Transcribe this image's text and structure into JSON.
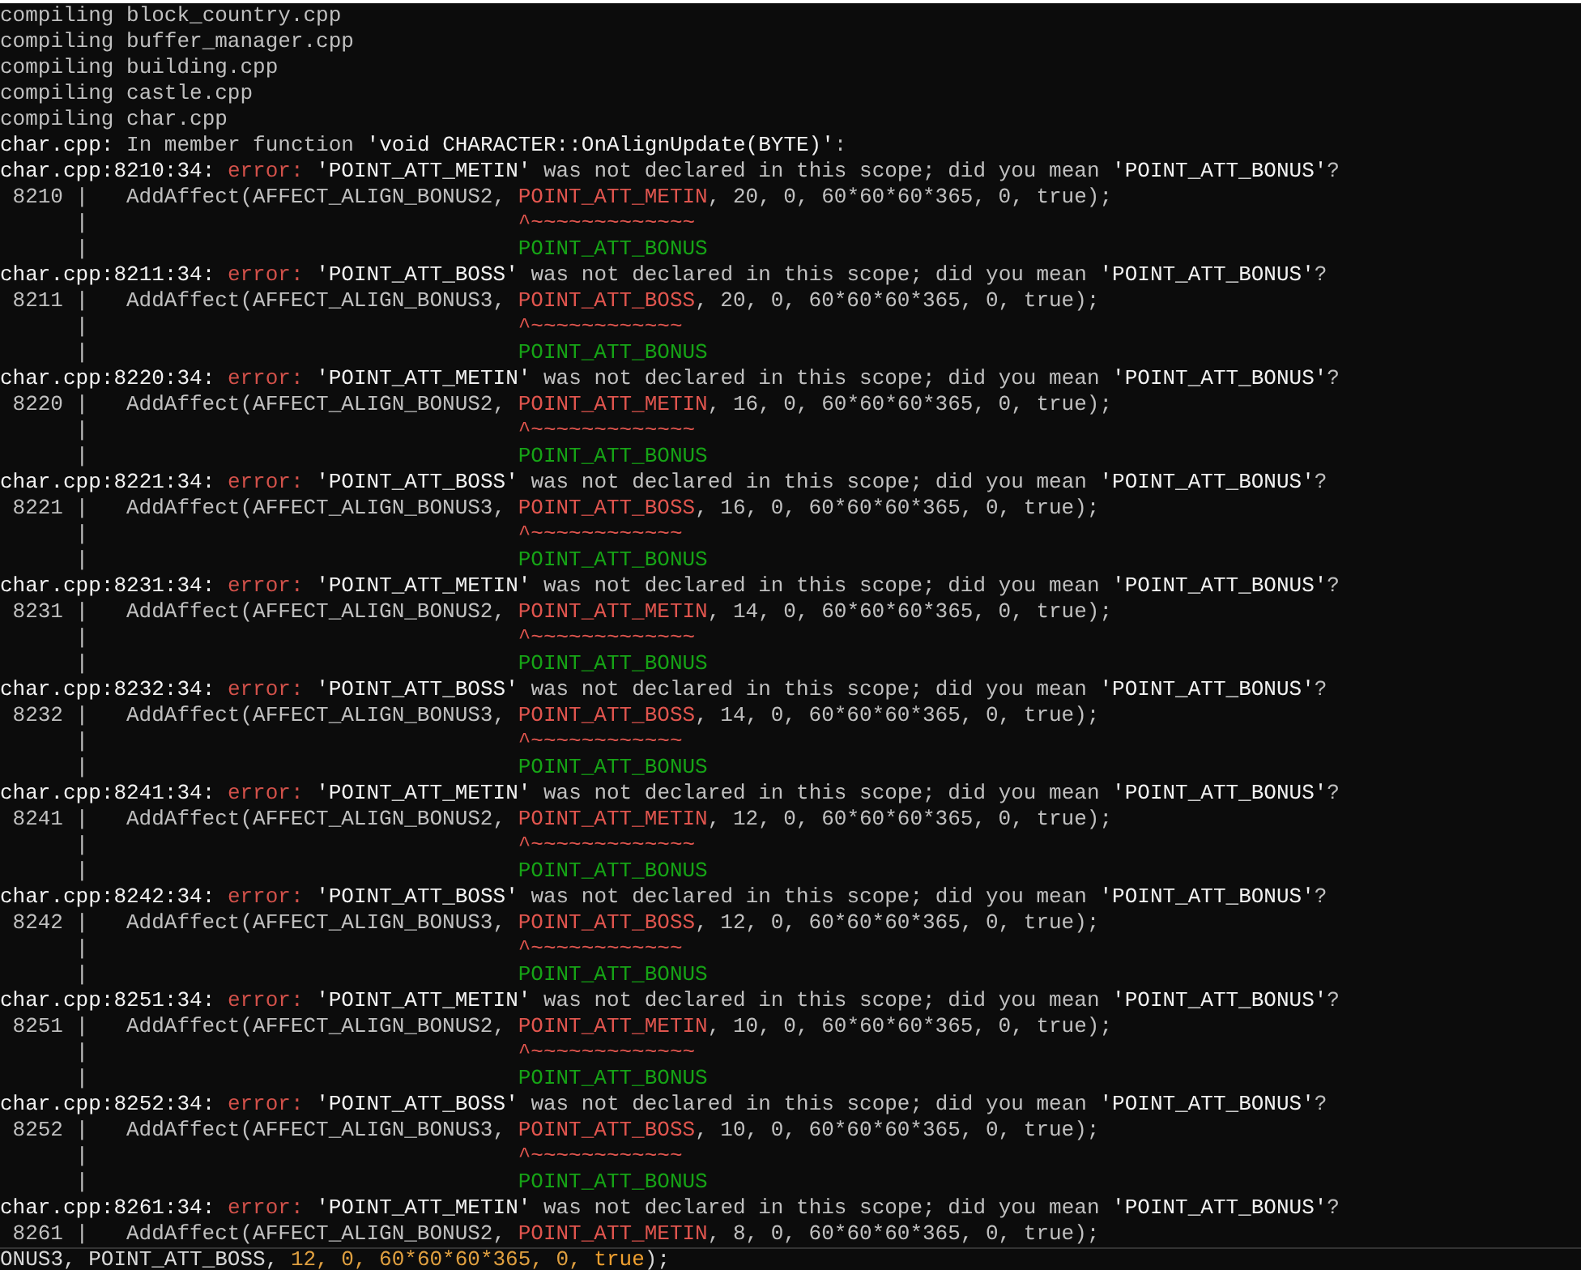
{
  "lines": [
    {
      "kind": "compile",
      "text": "compiling block_country.cpp"
    },
    {
      "kind": "compile",
      "text": "compiling buffer_manager.cpp"
    },
    {
      "kind": "compile",
      "text": "compiling building.cpp"
    },
    {
      "kind": "compile",
      "text": "compiling castle.cpp"
    },
    {
      "kind": "compile",
      "text": "compiling char.cpp"
    },
    {
      "kind": "note",
      "location": "char.cpp:",
      "message": "In member function **'void CHARACTER::OnAlignUpdate(BYTE)'**:"
    },
    {
      "kind": "diagnostic",
      "location": "char.cpp:8210:34:",
      "severity": "error:",
      "message": "**'POINT_ATT_METIN'** was not declared in this scope; did you mean **'POINT_ATT_BONUS'**?",
      "line_number": "8210",
      "gutter": "|",
      "code_before": "AddAffect(AFFECT_ALIGN_BONUS2, ",
      "code_highlight": "POINT_ATT_METIN",
      "code_after": ", 20, 0, 60*60*60*365, 0, true);",
      "caret_gutter": "|",
      "caret": "^~~~~~~~~~~~~~",
      "fixit_gutter": "|",
      "fixit": "POINT_ATT_BONUS"
    },
    {
      "kind": "diagnostic",
      "location": "char.cpp:8211:34:",
      "severity": "error:",
      "message": "**'POINT_ATT_BOSS'** was not declared in this scope; did you mean **'POINT_ATT_BONUS'**?",
      "line_number": "8211",
      "gutter": "|",
      "code_before": "AddAffect(AFFECT_ALIGN_BONUS3, ",
      "code_highlight": "POINT_ATT_BOSS",
      "code_after": ", 20, 0, 60*60*60*365, 0, true);",
      "caret_gutter": "|",
      "caret": "^~~~~~~~~~~~~",
      "fixit_gutter": "|",
      "fixit": "POINT_ATT_BONUS"
    },
    {
      "kind": "diagnostic",
      "location": "char.cpp:8220:34:",
      "severity": "error:",
      "message": "**'POINT_ATT_METIN'** was not declared in this scope; did you mean **'POINT_ATT_BONUS'**?",
      "line_number": "8220",
      "gutter": "|",
      "code_before": "AddAffect(AFFECT_ALIGN_BONUS2, ",
      "code_highlight": "POINT_ATT_METIN",
      "code_after": ", 16, 0, 60*60*60*365, 0, true);",
      "caret_gutter": "|",
      "caret": "^~~~~~~~~~~~~~",
      "fixit_gutter": "|",
      "fixit": "POINT_ATT_BONUS"
    },
    {
      "kind": "diagnostic",
      "location": "char.cpp:8221:34:",
      "severity": "error:",
      "message": "**'POINT_ATT_BOSS'** was not declared in this scope; did you mean **'POINT_ATT_BONUS'**?",
      "line_number": "8221",
      "gutter": "|",
      "code_before": "AddAffect(AFFECT_ALIGN_BONUS3, ",
      "code_highlight": "POINT_ATT_BOSS",
      "code_after": ", 16, 0, 60*60*60*365, 0, true);",
      "caret_gutter": "|",
      "caret": "^~~~~~~~~~~~~",
      "fixit_gutter": "|",
      "fixit": "POINT_ATT_BONUS"
    },
    {
      "kind": "diagnostic",
      "location": "char.cpp:8231:34:",
      "severity": "error:",
      "message": "**'POINT_ATT_METIN'** was not declared in this scope; did you mean **'POINT_ATT_BONUS'**?",
      "line_number": "8231",
      "gutter": "|",
      "code_before": "AddAffect(AFFECT_ALIGN_BONUS2, ",
      "code_highlight": "POINT_ATT_METIN",
      "code_after": ", 14, 0, 60*60*60*365, 0, true);",
      "caret_gutter": "|",
      "caret": "^~~~~~~~~~~~~~",
      "fixit_gutter": "|",
      "fixit": "POINT_ATT_BONUS"
    },
    {
      "kind": "diagnostic",
      "location": "char.cpp:8232:34:",
      "severity": "error:",
      "message": "**'POINT_ATT_BOSS'** was not declared in this scope; did you mean **'POINT_ATT_BONUS'**?",
      "line_number": "8232",
      "gutter": "|",
      "code_before": "AddAffect(AFFECT_ALIGN_BONUS3, ",
      "code_highlight": "POINT_ATT_BOSS",
      "code_after": ", 14, 0, 60*60*60*365, 0, true);",
      "caret_gutter": "|",
      "caret": "^~~~~~~~~~~~~",
      "fixit_gutter": "|",
      "fixit": "POINT_ATT_BONUS"
    },
    {
      "kind": "diagnostic",
      "location": "char.cpp:8241:34:",
      "severity": "error:",
      "message": "**'POINT_ATT_METIN'** was not declared in this scope; did you mean **'POINT_ATT_BONUS'**?",
      "line_number": "8241",
      "gutter": "|",
      "code_before": "AddAffect(AFFECT_ALIGN_BONUS2, ",
      "code_highlight": "POINT_ATT_METIN",
      "code_after": ", 12, 0, 60*60*60*365, 0, true);",
      "caret_gutter": "|",
      "caret": "^~~~~~~~~~~~~~",
      "fixit_gutter": "|",
      "fixit": "POINT_ATT_BONUS"
    },
    {
      "kind": "diagnostic",
      "location": "char.cpp:8242:34:",
      "severity": "error:",
      "message": "**'POINT_ATT_BOSS'** was not declared in this scope; did you mean **'POINT_ATT_BONUS'**?",
      "line_number": "8242",
      "gutter": "|",
      "code_before": "AddAffect(AFFECT_ALIGN_BONUS3, ",
      "code_highlight": "POINT_ATT_BOSS",
      "code_after": ", 12, 0, 60*60*60*365, 0, true);",
      "caret_gutter": "|",
      "caret": "^~~~~~~~~~~~~",
      "fixit_gutter": "|",
      "fixit": "POINT_ATT_BONUS"
    },
    {
      "kind": "diagnostic",
      "location": "char.cpp:8251:34:",
      "severity": "error:",
      "message": "**'POINT_ATT_METIN'** was not declared in this scope; did you mean **'POINT_ATT_BONUS'**?",
      "line_number": "8251",
      "gutter": "|",
      "code_before": "AddAffect(AFFECT_ALIGN_BONUS2, ",
      "code_highlight": "POINT_ATT_METIN",
      "code_after": ", 10, 0, 60*60*60*365, 0, true);",
      "caret_gutter": "|",
      "caret": "^~~~~~~~~~~~~~",
      "fixit_gutter": "|",
      "fixit": "POINT_ATT_BONUS"
    },
    {
      "kind": "diagnostic",
      "location": "char.cpp:8252:34:",
      "severity": "error:",
      "message": "**'POINT_ATT_BOSS'** was not declared in this scope; did you mean **'POINT_ATT_BONUS'**?",
      "line_number": "8252",
      "gutter": "|",
      "code_before": "AddAffect(AFFECT_ALIGN_BONUS3, ",
      "code_highlight": "POINT_ATT_BOSS",
      "code_after": ", 10, 0, 60*60*60*365, 0, true);",
      "caret_gutter": "|",
      "caret": "^~~~~~~~~~~~~",
      "fixit_gutter": "|",
      "fixit": "POINT_ATT_BONUS"
    },
    {
      "kind": "diagnostic",
      "location": "char.cpp:8261:34:",
      "severity": "error:",
      "message": "**'POINT_ATT_METIN'** was not declared in this scope; did you mean **'POINT_ATT_BONUS'**?",
      "line_number": "8261",
      "gutter": "|",
      "code_before": "AddAffect(AFFECT_ALIGN_BONUS2, ",
      "code_highlight": "POINT_ATT_METIN",
      "code_after": ", 8, 0, 60*60*60*365, 0, true);"
    },
    {
      "kind": "fragment",
      "parts": [
        {
          "color": "#d8d8d8",
          "text": "ONUS3, POINT_ATT_BOSS, "
        },
        {
          "color": "#e0a040",
          "text": "12, 0, 60*60*60*365, 0, "
        },
        {
          "color": "#f0a030",
          "text": "true"
        },
        {
          "color": "#d8d8d8",
          "text": ");"
        }
      ]
    }
  ]
}
